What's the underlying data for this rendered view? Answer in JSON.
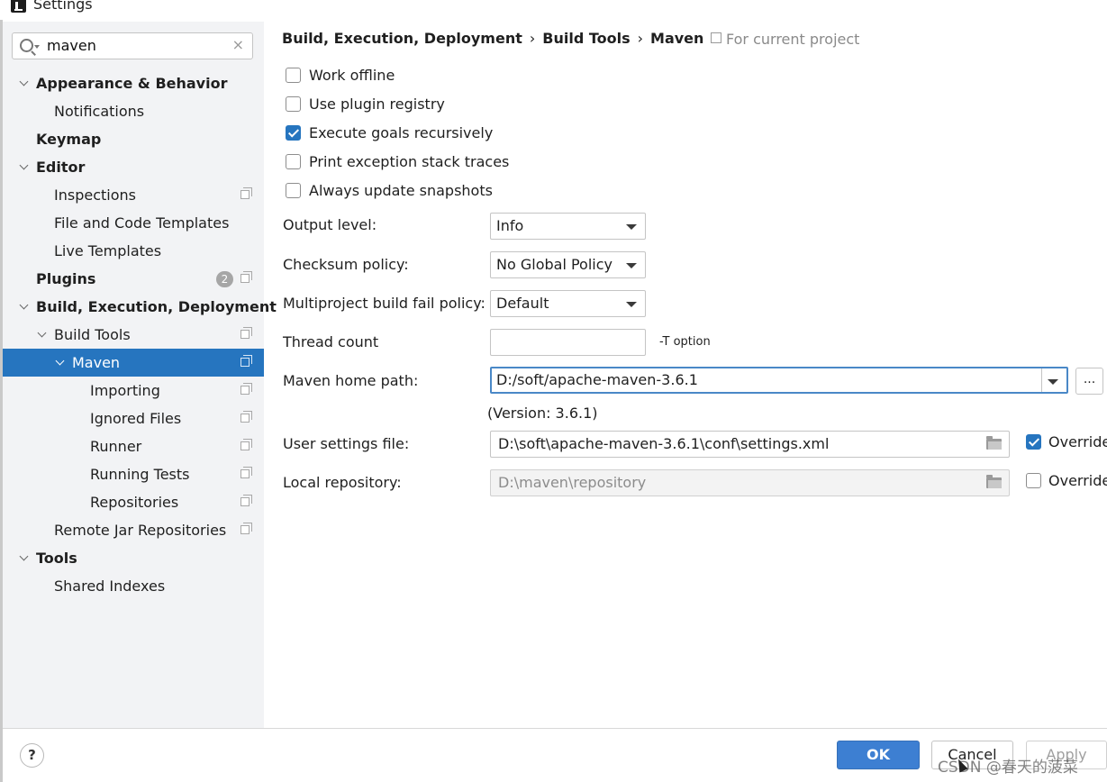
{
  "window": {
    "title": "Settings"
  },
  "search": {
    "value": "maven",
    "clear_glyph": "×"
  },
  "sidebar": {
    "items": [
      {
        "label": "Appearance & Behavior"
      },
      {
        "label": "Notifications"
      },
      {
        "label": "Keymap"
      },
      {
        "label": "Editor"
      },
      {
        "label": "Inspections"
      },
      {
        "label": "File and Code Templates"
      },
      {
        "label": "Live Templates"
      },
      {
        "label": "Plugins",
        "badge": "2"
      },
      {
        "label": "Build, Execution, Deployment"
      },
      {
        "label": "Build Tools"
      },
      {
        "label": "Maven"
      },
      {
        "label": "Importing"
      },
      {
        "label": "Ignored Files"
      },
      {
        "label": "Runner"
      },
      {
        "label": "Running Tests"
      },
      {
        "label": "Repositories"
      },
      {
        "label": "Remote Jar Repositories"
      },
      {
        "label": "Tools"
      },
      {
        "label": "Shared Indexes"
      }
    ]
  },
  "breadcrumb": {
    "items": [
      "Build, Execution, Deployment",
      "Build Tools",
      "Maven"
    ],
    "separator": "›",
    "scope": "For current project"
  },
  "options": [
    {
      "label": "Work offline",
      "checked": false
    },
    {
      "label": "Use plugin registry",
      "checked": false
    },
    {
      "label": "Execute goals recursively",
      "checked": true
    },
    {
      "label": "Print exception stack traces",
      "checked": false
    },
    {
      "label": "Always update snapshots",
      "checked": false
    }
  ],
  "fields": {
    "output_level": {
      "label": "Output level:",
      "value": "Info"
    },
    "checksum_policy": {
      "label": "Checksum policy:",
      "value": "No Global Policy"
    },
    "multiproject_fail": {
      "label": "Multiproject build fail policy:",
      "value": "Default"
    },
    "thread_count": {
      "label": "Thread count",
      "value": "",
      "note": "-T option"
    },
    "maven_home": {
      "label": "Maven home path:",
      "value": "D:/soft/apache-maven-3.6.1",
      "version": "(Version: 3.6.1)",
      "browse": "..."
    },
    "user_settings": {
      "label": "User settings file:",
      "value": "D:\\soft\\apache-maven-3.6.1\\conf\\settings.xml",
      "override_label": "Override",
      "override": true
    },
    "local_repo": {
      "label": "Local repository:",
      "value": "D:\\maven\\repository",
      "override_label": "Override",
      "override": false
    }
  },
  "footer": {
    "help": "?",
    "ok": "OK",
    "cancel": "Cancel",
    "apply": "Apply",
    "watermark": "CSDN @春天的菠菜"
  },
  "colors": {
    "accent": "#2675bf",
    "ok_button": "#3d7fd2",
    "sidebar_bg": "#f2f3f5"
  }
}
